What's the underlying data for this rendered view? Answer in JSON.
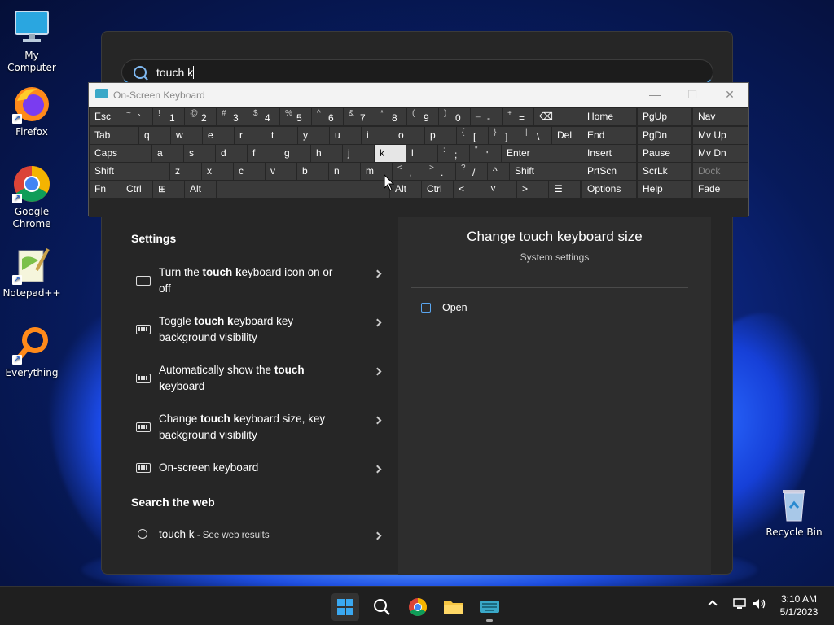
{
  "desktop": {
    "icons": [
      {
        "label": "My Computer"
      },
      {
        "label": "Firefox"
      },
      {
        "label": "Google Chrome"
      },
      {
        "label": "Notepad++"
      },
      {
        "label": "Everything"
      },
      {
        "label": "Recycle Bin"
      }
    ]
  },
  "start": {
    "search_value": "touch k",
    "settings_header": "Settings",
    "results": [
      {
        "pre": "Turn the ",
        "bold": "touch k",
        "post": "eyboard icon on or off",
        "icon": "display-icon"
      },
      {
        "pre": "Toggle ",
        "bold": "touch k",
        "post": "eyboard key background visibility",
        "icon": "keyboard-icon"
      },
      {
        "pre": "Automatically show the ",
        "bold": "touch k",
        "post": "eyboard",
        "icon": "keyboard-icon"
      },
      {
        "pre": "Change ",
        "bold": "touch k",
        "post": "eyboard size, key background visibility",
        "icon": "keyboard-icon"
      },
      {
        "pre": "On-screen keyboard",
        "bold": "",
        "post": "",
        "icon": "keyboard-icon"
      }
    ],
    "web_header": "Search the web",
    "web_query": "touch k",
    "web_suffix": " - See web results",
    "preview": {
      "title": "Change touch keyboard size",
      "subtitle": "System settings",
      "open_label": "Open"
    }
  },
  "osk": {
    "title": "On-Screen Keyboard",
    "rows": [
      [
        "Esc",
        "~ `",
        "! 1",
        "@ 2",
        "# 3",
        "$ 4",
        "% 5",
        "^ 6",
        "& 7",
        "* 8",
        "( 9",
        ") 0",
        "_ -",
        "+ =",
        "⌫",
        "Home",
        "PgUp",
        "Nav"
      ],
      [
        "Tab",
        "q",
        "w",
        "e",
        "r",
        "t",
        "y",
        "u",
        "i",
        "o",
        "p",
        "{ [",
        "} ]",
        "| \\",
        "Del",
        "End",
        "PgDn",
        "Mv Up"
      ],
      [
        "Caps",
        "a",
        "s",
        "d",
        "f",
        "g",
        "h",
        "j",
        "k",
        "l",
        ": ;",
        "\" '",
        "Enter",
        "Insert",
        "Pause",
        "Mv Dn"
      ],
      [
        "Shift",
        "z",
        "x",
        "c",
        "v",
        "b",
        "n",
        "m",
        "< ,",
        "> .",
        "? /",
        "^",
        "Shift",
        "PrtScn",
        "ScrLk",
        "Dock"
      ],
      [
        "Fn",
        "Ctrl",
        "⊞",
        "Alt",
        "",
        "Alt",
        "Ctrl",
        "<",
        "˅",
        ">",
        "☰",
        "Options",
        "Help",
        "Fade"
      ]
    ],
    "highlighted_key": "k"
  },
  "taskbar": {
    "time": "3:10 AM",
    "date": "5/1/2023"
  }
}
